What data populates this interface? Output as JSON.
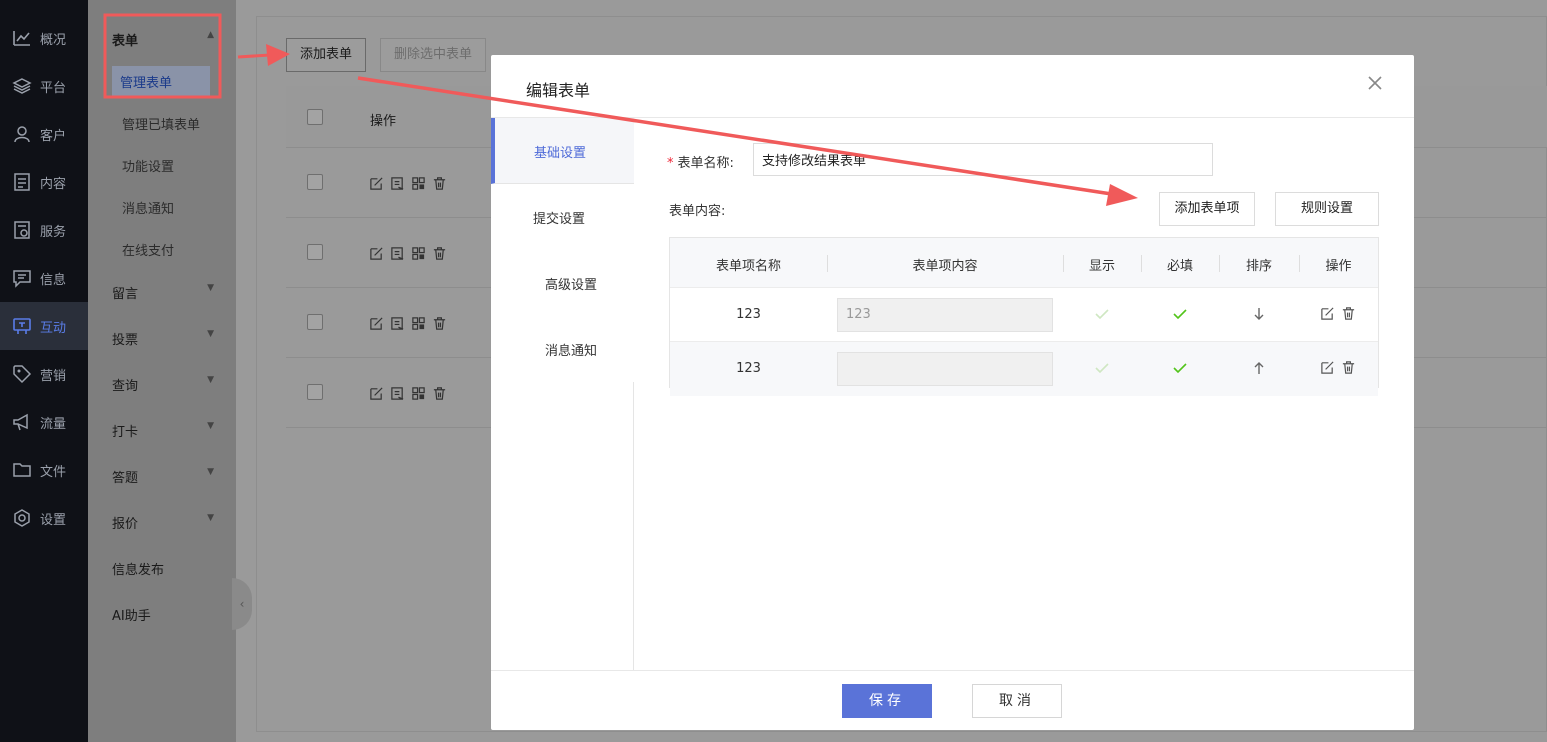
{
  "nav": {
    "items": [
      {
        "label": "概况",
        "icon": "chart-line-icon"
      },
      {
        "label": "平台",
        "icon": "layers-icon"
      },
      {
        "label": "客户",
        "icon": "user-icon"
      },
      {
        "label": "内容",
        "icon": "document-icon"
      },
      {
        "label": "服务",
        "icon": "service-icon"
      },
      {
        "label": "信息",
        "icon": "message-icon"
      },
      {
        "label": "互动",
        "icon": "interact-icon",
        "active": true
      },
      {
        "label": "营销",
        "icon": "tag-icon"
      },
      {
        "label": "流量",
        "icon": "megaphone-icon"
      },
      {
        "label": "文件",
        "icon": "folder-icon"
      },
      {
        "label": "设置",
        "icon": "settings-icon"
      }
    ]
  },
  "sidebar": {
    "group_form": "表单",
    "children": [
      "管理表单",
      "管理已填表单",
      "功能设置",
      "消息通知",
      "在线支付"
    ],
    "groups": [
      "留言",
      "投票",
      "查询",
      "打卡",
      "答题",
      "报价",
      "信息发布",
      "AI助手"
    ]
  },
  "background": {
    "add_form_btn": "添加表单",
    "delete_selected_btn": "删除选中表单",
    "col_action": "操作"
  },
  "modal": {
    "title": "编辑表单",
    "tabs": [
      "基础设置",
      "提交设置",
      "高级设置",
      "消息通知"
    ],
    "form_name_label": "表单名称:",
    "form_name_value": "支持修改结果表单",
    "form_content_label": "表单内容:",
    "add_item_btn": "添加表单项",
    "rule_btn": "规则设置",
    "table": {
      "headers": [
        "表单项名称",
        "表单项内容",
        "显示",
        "必填",
        "排序",
        "操作"
      ],
      "rows": [
        {
          "name": "123",
          "content": "123",
          "sort": "down"
        },
        {
          "name": "123",
          "content": "",
          "sort": "up"
        }
      ]
    },
    "save_btn": "保存",
    "cancel_btn": "取消"
  },
  "colors": {
    "accent": "#5a73d8",
    "check": "#52c41a",
    "annotation": "#f05a5a"
  }
}
